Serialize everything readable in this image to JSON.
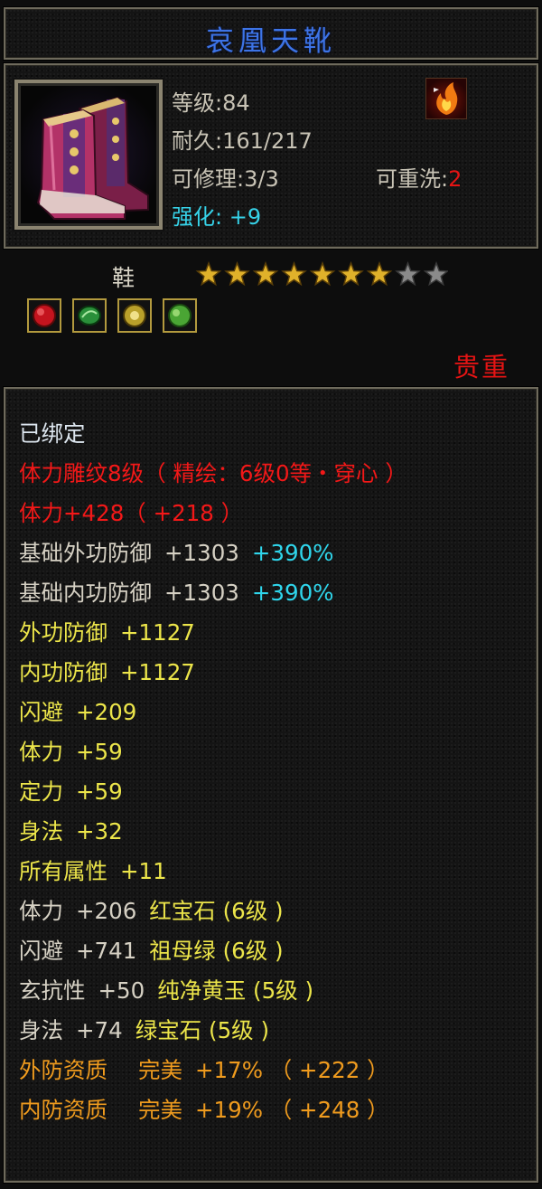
{
  "item": {
    "name": "哀凰天靴",
    "level_label": "等级:",
    "level": "84",
    "durability_label": "耐久:",
    "durability": "161/217",
    "repair_label": "可修理:",
    "repair": "3/3",
    "rewash_label": "可重洗:",
    "rewash": "2",
    "enhance_label": "强化:",
    "enhance": "+9",
    "type": "鞋",
    "stars_filled": 7,
    "stars_total": 9,
    "quality": "贵重",
    "gem_slots": [
      {
        "icon": "red-gem-icon",
        "color": "#d8202a"
      },
      {
        "icon": "emerald-gem-icon",
        "color": "#2f9a3c"
      },
      {
        "icon": "yellow-jade-gem-icon",
        "color": "#c9b12e"
      },
      {
        "icon": "green-gem-icon",
        "color": "#56b93a"
      }
    ]
  },
  "attributes": {
    "bound": "已绑定",
    "carving": "体力雕纹8级（ 精绘：6级0等・穿心 ）",
    "stamina_main": "体力+428（ +218 ）",
    "base_outer_def": {
      "label": "基础外功防御",
      "value": "+1303",
      "bonus": "+390%"
    },
    "base_inner_def": {
      "label": "基础内功防御",
      "value": "+1303",
      "bonus": "+390%"
    },
    "outer_def": {
      "label": "外功防御",
      "value": "+1127"
    },
    "inner_def": {
      "label": "内功防御",
      "value": "+1127"
    },
    "dodge": {
      "label": "闪避",
      "value": "+209"
    },
    "stamina": {
      "label": "体力",
      "value": "+59"
    },
    "focus": {
      "label": "定力",
      "value": "+59"
    },
    "agility": {
      "label": "身法",
      "value": "+32"
    },
    "all_attr": {
      "label": "所有属性",
      "value": "+11"
    },
    "gem1": {
      "label": "体力",
      "value": "+206",
      "gem": "红宝石 (6级 )"
    },
    "gem2": {
      "label": "闪避",
      "value": "+741",
      "gem": "祖母绿 (6级 )"
    },
    "gem3": {
      "label": "玄抗性",
      "value": "+50",
      "gem": "纯净黄玉 (5级 )"
    },
    "gem4": {
      "label": "身法",
      "value": "+74",
      "gem": "绿宝石 (5级 )"
    },
    "outer_aptitude": {
      "label": "外防资质",
      "grade": "完美",
      "value": "+17% （ +222 ）"
    },
    "inner_aptitude": {
      "label": "内防资质",
      "grade": "完美",
      "value": "+19% （ +248 ）"
    }
  },
  "colors": {
    "title": "#3d74e6",
    "red": "#f21818",
    "cyan": "#2fd6ec",
    "yellow": "#ece54a",
    "orange": "#ef9b1e",
    "star_gold": "#e0b12a",
    "star_grey": "#8a8a8a"
  }
}
